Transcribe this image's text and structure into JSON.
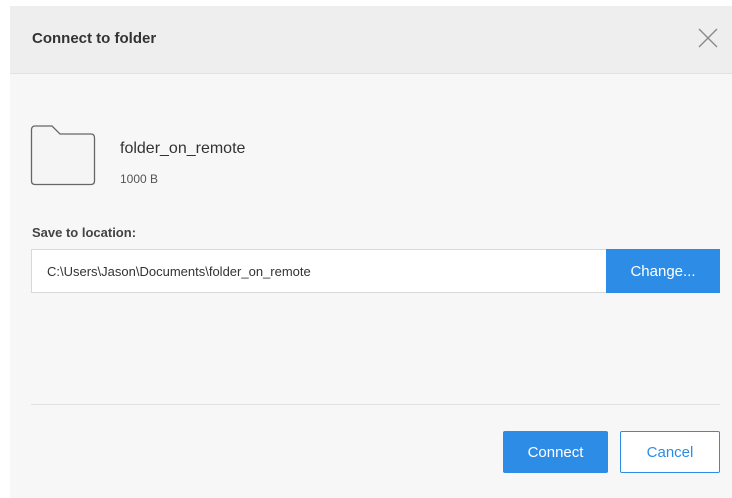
{
  "dialog": {
    "title": "Connect to folder",
    "close_icon": "close-icon"
  },
  "item": {
    "icon": "folder-icon",
    "name": "folder_on_remote",
    "size": "1000 B"
  },
  "location": {
    "label": "Save to location:",
    "path": "C:\\Users\\Jason\\Documents\\folder_on_remote",
    "change_label": "Change..."
  },
  "actions": {
    "connect_label": "Connect",
    "cancel_label": "Cancel"
  },
  "colors": {
    "accent": "#2d8ce6",
    "dialog_background": "#f7f7f7",
    "header_background": "#eeeeee"
  }
}
